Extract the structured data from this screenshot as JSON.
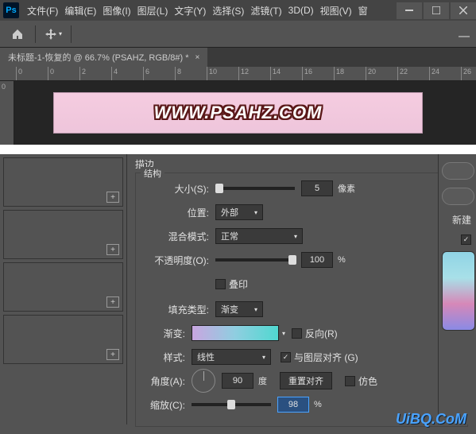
{
  "app_logo": "Ps",
  "menu": [
    "文件(F)",
    "编辑(E)",
    "图像(I)",
    "图层(L)",
    "文字(Y)",
    "选择(S)",
    "滤镜(T)",
    "3D(D)",
    "视图(V)",
    "窗"
  ],
  "tab": {
    "title": "未标题-1-恢复的 @ 66.7% (PSAHZ, RGB/8#) *"
  },
  "ruler_marks": [
    0,
    0,
    2,
    4,
    6,
    8,
    10,
    12,
    14,
    16,
    18,
    20,
    22,
    24,
    26
  ],
  "ruler_v": "0",
  "banner_text": "WWW.PSAHZ.COM",
  "dialog": {
    "title": "描边",
    "structure_label": "结构",
    "size_label": "大小(S):",
    "size_value": "5",
    "size_unit": "像素",
    "position_label": "位置:",
    "position_value": "外部",
    "blend_label": "混合模式:",
    "blend_value": "正常",
    "opacity_label": "不透明度(O):",
    "opacity_value": "100",
    "opacity_unit": "%",
    "overprint_label": "叠印",
    "filltype_label": "填充类型:",
    "filltype_value": "渐变",
    "gradient_label": "渐变:",
    "reverse_label": "反向(R)",
    "style_label": "样式:",
    "style_value": "线性",
    "align_label": "与图层对齐 (G)",
    "angle_label": "角度(A):",
    "angle_value": "90",
    "angle_unit": "度",
    "reset_align": "重置对齐",
    "dither_label": "仿色",
    "scale_label": "缩放(C):",
    "scale_value": "98",
    "scale_unit": "%"
  },
  "right": {
    "new_label": "新建",
    "checkbox_checked": "✓"
  },
  "watermark": "UiBQ.CoM"
}
